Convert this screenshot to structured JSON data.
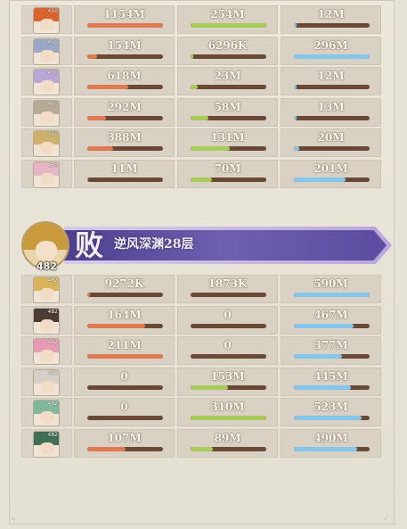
{
  "team1": {
    "rows": [
      {
        "level": "450",
        "hair": "#d8632e",
        "damage": {
          "text": "1154M",
          "pct": 1.0
        },
        "heal": {
          "text": "254M",
          "pct": 1.0
        },
        "tank": {
          "text": "12M",
          "pct": 0.04
        }
      },
      {
        "level": "450",
        "hair": "#9aa6c6",
        "damage": {
          "text": "154M",
          "pct": 0.13
        },
        "heal": {
          "text": "6296K",
          "pct": 0.03
        },
        "tank": {
          "text": "296M",
          "pct": 1.0
        }
      },
      {
        "level": "450",
        "hair": "#b9a7d8",
        "damage": {
          "text": "618M",
          "pct": 0.54
        },
        "heal": {
          "text": "23M",
          "pct": 0.09
        },
        "tank": {
          "text": "12M",
          "pct": 0.04
        }
      },
      {
        "level": "450",
        "hair": "#b8ab96",
        "damage": {
          "text": "292M",
          "pct": 0.25
        },
        "heal": {
          "text": "58M",
          "pct": 0.23
        },
        "tank": {
          "text": "13M",
          "pct": 0.04
        }
      },
      {
        "level": "450",
        "hair": "#cdb06a",
        "damage": {
          "text": "388M",
          "pct": 0.34
        },
        "heal": {
          "text": "131M",
          "pct": 0.52
        },
        "tank": {
          "text": "20M",
          "pct": 0.07
        }
      },
      {
        "level": "450",
        "hair": "#e6b6c6",
        "damage": {
          "text": "11M",
          "pct": 0.01
        },
        "heal": {
          "text": "70M",
          "pct": 0.28
        },
        "tank": {
          "text": "201M",
          "pct": 0.68
        }
      }
    ]
  },
  "battle": {
    "result": "败",
    "stage": "逆风深渊28层",
    "leader_level": "482"
  },
  "team2": {
    "rows": [
      {
        "level": "482",
        "hair": "#d9b45a",
        "damage": {
          "text": "9272K",
          "pct": 0.04
        },
        "heal": {
          "text": "1873K",
          "pct": 0.0
        },
        "tank": {
          "text": "590M",
          "pct": 1.0
        }
      },
      {
        "level": "482",
        "hair": "#4a3b36",
        "damage": {
          "text": "164M",
          "pct": 0.77
        },
        "heal": {
          "text": "0",
          "pct": 0.0
        },
        "tank": {
          "text": "467M",
          "pct": 0.79
        }
      },
      {
        "level": "482",
        "hair": "#e79ab3",
        "damage": {
          "text": "211M",
          "pct": 1.0
        },
        "heal": {
          "text": "0",
          "pct": 0.0
        },
        "tank": {
          "text": "377M",
          "pct": 0.64
        }
      },
      {
        "level": "482",
        "hair": "#d6d0c8",
        "damage": {
          "text": "0",
          "pct": 0.0
        },
        "heal": {
          "text": "153M",
          "pct": 0.49
        },
        "tank": {
          "text": "445M",
          "pct": 0.75
        }
      },
      {
        "level": "482",
        "hair": "#7fb89a",
        "damage": {
          "text": "0",
          "pct": 0.0
        },
        "heal": {
          "text": "310M",
          "pct": 1.0
        },
        "tank": {
          "text": "523M",
          "pct": 0.89
        }
      },
      {
        "level": "482",
        "hair": "#3f6f55",
        "damage": {
          "text": "107M",
          "pct": 0.51
        },
        "heal": {
          "text": "89M",
          "pct": 0.29
        },
        "tank": {
          "text": "490M",
          "pct": 0.83
        }
      }
    ]
  },
  "colors": {
    "damage": "#e07a52",
    "heal": "#a8cc5a",
    "tank": "#86c6ec",
    "banner": "#5b4c9f"
  }
}
